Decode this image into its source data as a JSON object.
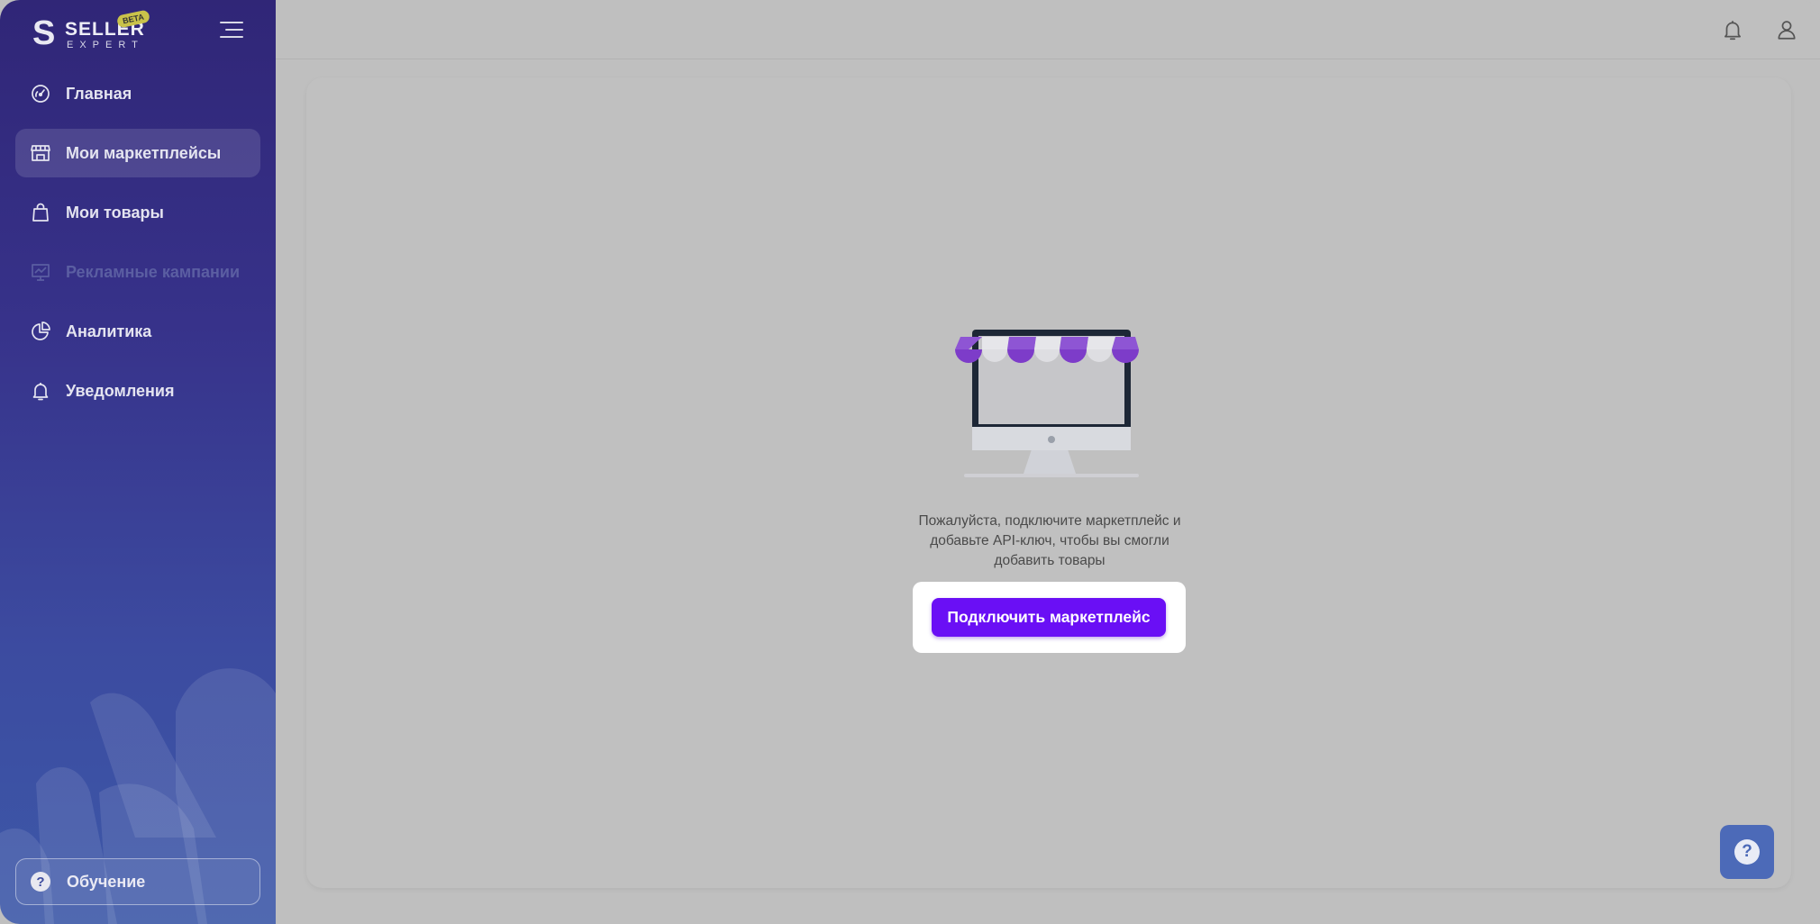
{
  "brand": {
    "name": "SELLER",
    "sub": "EXPERT",
    "badge": "BETA"
  },
  "sidebar": {
    "items": [
      {
        "label": "Главная",
        "icon": "dashboard-gauge-icon",
        "state": "normal"
      },
      {
        "label": "Мои маркетплейсы",
        "icon": "store-icon",
        "state": "active"
      },
      {
        "label": "Мои товары",
        "icon": "shopping-bag-icon",
        "state": "normal"
      },
      {
        "label": "Рекламные кампании",
        "icon": "presentation-chart-icon",
        "state": "disabled"
      },
      {
        "label": "Аналитика",
        "icon": "pie-chart-icon",
        "state": "normal"
      },
      {
        "label": "Уведомления",
        "icon": "bell-icon",
        "state": "normal"
      }
    ],
    "learn_label": "Обучение"
  },
  "topbar": {
    "icons": [
      "bell-icon",
      "user-icon"
    ]
  },
  "main": {
    "empty_message": "Пожалуйста, подключите маркетплейс и добавьте API-ключ, чтобы вы смогли добавить товары",
    "cta_label": "Подключить маркетплейс",
    "help_icon": "question-icon"
  },
  "colors": {
    "sidebar_top": "#302677",
    "sidebar_bottom": "#3d58a8",
    "primary_button": "#6a0ff5",
    "overlay_background": "#bfbfbf",
    "help_button": "#4c6ab8"
  }
}
